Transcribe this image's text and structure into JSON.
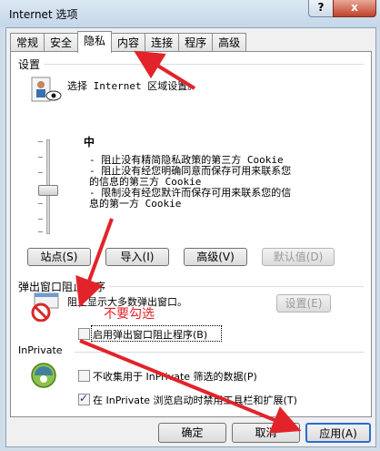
{
  "window": {
    "title": "Internet 选项",
    "help_label": "?",
    "close_label": "x"
  },
  "tabs": [
    "常规",
    "安全",
    "隐私",
    "内容",
    "连接",
    "程序",
    "高级"
  ],
  "settings": {
    "title": "设置",
    "instruction": "选择 Internet 区域设置。",
    "level": "中",
    "bullets": [
      "- 阻止没有精简隐私政策的第三方 Cookie",
      "- 阻止没有经您明确同意而保存可用来联系您的信息的第三方 Cookie",
      "- 限制没有经您默许而保存可用来联系您的信息的第一方 Cookie"
    ]
  },
  "buttons": {
    "sites": "站点(S)",
    "import": "导入(I)",
    "advanced": "高级(V)",
    "default": "默认值(D)",
    "popup_settings": "设置(E)",
    "ok": "确定",
    "cancel": "取消",
    "apply": "应用(A)"
  },
  "popup": {
    "title": "弹出窗口阻止程序",
    "description": "阻止显示大多数弹出窗口。",
    "enable_label": "启用弹出窗口阻止程序(B)",
    "enable_checked": false
  },
  "inprivate": {
    "title": "InPrivate",
    "option1_label": "不收集用于 InPrivate 筛选的数据(P)",
    "option1_checked": false,
    "option2_label": "在 InPrivate 浏览启动时禁用工具栏和扩展(T)",
    "option2_checked": true
  },
  "annotation": {
    "text": "不要勾选",
    "color": "#e2232a"
  }
}
